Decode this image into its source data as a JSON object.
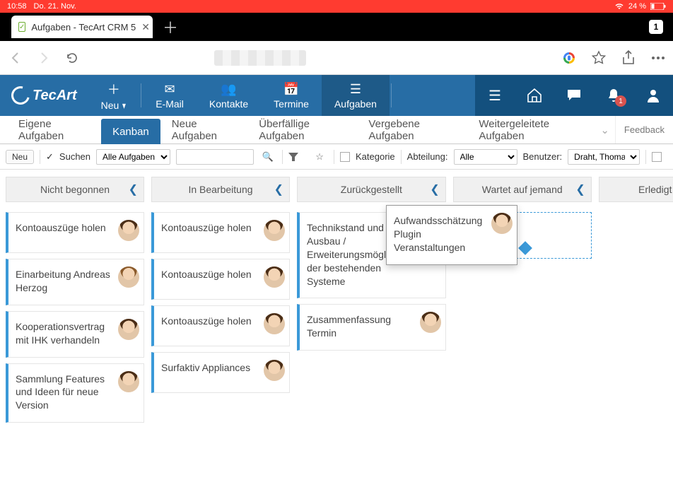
{
  "status": {
    "time": "10:58",
    "date": "Do. 21. Nov.",
    "battery": "24 %"
  },
  "browser": {
    "tab_title": "Aufgaben - TecArt CRM 5",
    "tab_count": "1"
  },
  "app": {
    "brand": "TecArt",
    "nav": {
      "neu": "Neu",
      "email": "E-Mail",
      "kontakte": "Kontakte",
      "termine": "Termine",
      "aufgaben": "Aufgaben"
    },
    "alert_count": "1"
  },
  "subnav": {
    "eigene": "Eigene Aufgaben",
    "kanban": "Kanban",
    "neue": "Neue Aufgaben",
    "ueberfaellig": "Überfällige Aufgaben",
    "vergeben": "Vergebene Aufgaben",
    "weitergeleitet": "Weitergeleitete Aufgaben",
    "feedback": "Feedback"
  },
  "filter": {
    "neu": "Neu",
    "suchen": "Suchen",
    "scope": "Alle Aufgaben",
    "kategorie": "Kategorie",
    "abteilung_label": "Abteilung:",
    "abteilung_value": "Alle",
    "benutzer_label": "Benutzer:",
    "benutzer_value": "Draht, Thomas"
  },
  "columns": [
    {
      "title": "Nicht begonnen"
    },
    {
      "title": "In Bearbeitung"
    },
    {
      "title": "Zurückgestellt"
    },
    {
      "title": "Wartet auf jemand"
    },
    {
      "title": "Erledigt"
    }
  ],
  "cards": {
    "c0": [
      {
        "title": "Kontoauszüge holen",
        "avatar": "m"
      },
      {
        "title": "Einarbeitung Andreas Herzog",
        "avatar": "f"
      },
      {
        "title": "Kooperationsvertrag mit IHK verhandeln",
        "avatar": "m"
      },
      {
        "title": "Sammlung Features und Ideen für neue Version",
        "avatar": "m"
      }
    ],
    "c1": [
      {
        "title": "Kontoauszüge holen",
        "avatar": "m"
      },
      {
        "title": "Kontoauszüge holen",
        "avatar": "m"
      },
      {
        "title": "Kontoauszüge holen",
        "avatar": "m"
      },
      {
        "title": "Surfaktiv Appliances",
        "avatar": "m"
      }
    ],
    "c2": [
      {
        "title": "Technikstand und Ausbau / Erweiterungsmöglichkeit der bestehenden Systeme",
        "avatar": "m"
      },
      {
        "title": "Zusammenfassung Termin",
        "avatar": "m"
      }
    ],
    "c3_drag": {
      "title": "Aufwandsschätzung Plugin Veranstaltungen",
      "avatar": "m"
    }
  }
}
